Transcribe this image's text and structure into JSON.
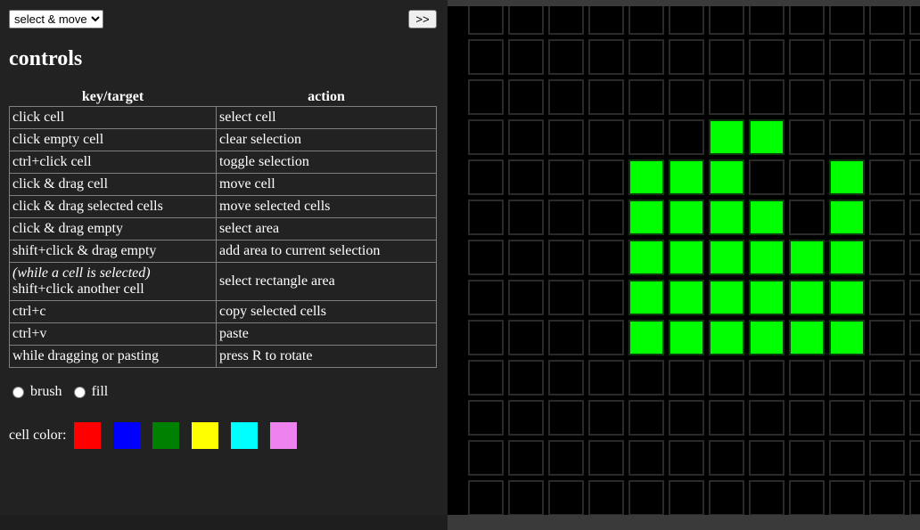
{
  "mode_select": {
    "value": "select & move",
    "options": [
      "select & move"
    ]
  },
  "panel_toggle_label": ">>",
  "title": "controls",
  "table": {
    "headers": [
      "key/target",
      "action"
    ],
    "rows": [
      {
        "key": "click cell",
        "action": "select cell"
      },
      {
        "key": "click empty cell",
        "action": "clear selection"
      },
      {
        "key": "ctrl+click cell",
        "action": "toggle selection"
      },
      {
        "key": "click & drag cell",
        "action": "move cell"
      },
      {
        "key": "click & drag selected cells",
        "action": "move selected cells"
      },
      {
        "key": "click & drag empty",
        "action": "select area"
      },
      {
        "key": "shift+click & drag empty",
        "action": "add area to current selection"
      },
      {
        "key_note": "(while a cell is selected)",
        "key": "shift+click another cell",
        "action": "select rectangle area"
      },
      {
        "key": "ctrl+c",
        "action": "copy selected cells"
      },
      {
        "key": "ctrl+v",
        "action": "paste"
      },
      {
        "key": "while dragging or pasting",
        "action": "press R to rotate"
      }
    ]
  },
  "tools": {
    "brush_label": "brush",
    "fill_label": "fill"
  },
  "cell_color": {
    "label": "cell color:",
    "swatches": [
      "#ff0000",
      "#0000ff",
      "#008000",
      "#ffff00",
      "#00ffff",
      "#ee82ee"
    ]
  },
  "board": {
    "colors": {
      "live": "#00ff00",
      "dead": "#000000"
    },
    "rows": 13,
    "cols": 12,
    "live_cells": [
      [
        3,
        6
      ],
      [
        3,
        7
      ],
      [
        4,
        4
      ],
      [
        4,
        5
      ],
      [
        4,
        6
      ],
      [
        4,
        9
      ],
      [
        5,
        4
      ],
      [
        5,
        5
      ],
      [
        5,
        6
      ],
      [
        5,
        7
      ],
      [
        5,
        9
      ],
      [
        6,
        4
      ],
      [
        6,
        5
      ],
      [
        6,
        6
      ],
      [
        6,
        7
      ],
      [
        6,
        8
      ],
      [
        6,
        9
      ],
      [
        7,
        4
      ],
      [
        7,
        5
      ],
      [
        7,
        6
      ],
      [
        7,
        7
      ],
      [
        7,
        8
      ],
      [
        7,
        9
      ],
      [
        8,
        4
      ],
      [
        8,
        5
      ],
      [
        8,
        6
      ],
      [
        8,
        7
      ],
      [
        8,
        8
      ],
      [
        8,
        9
      ]
    ]
  }
}
